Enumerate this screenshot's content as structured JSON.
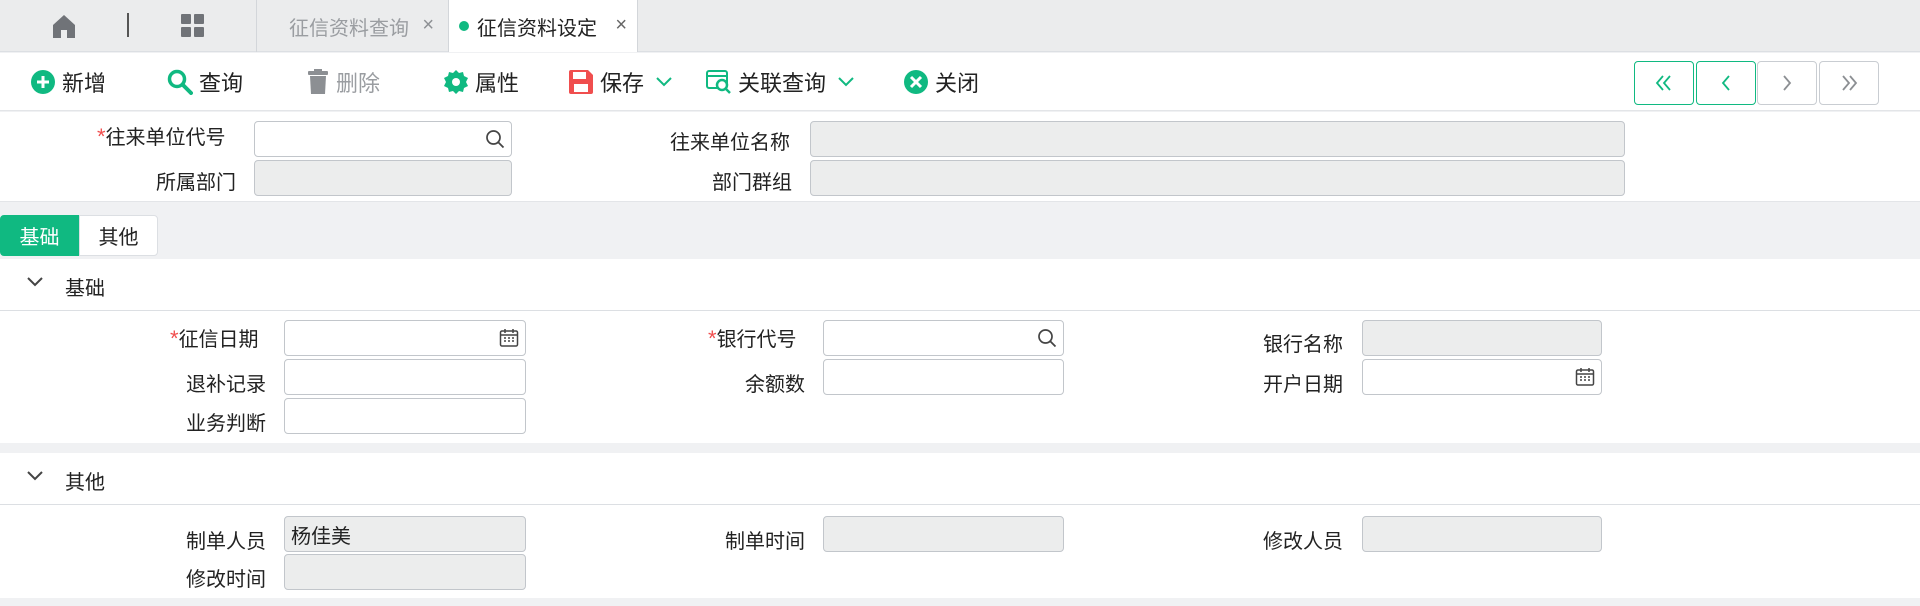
{
  "tabs": [
    {
      "label": "征信资料查询"
    },
    {
      "label": "征信资料设定"
    }
  ],
  "tab_close": "×",
  "toolbar": {
    "new_label": "新增",
    "query_label": "查询",
    "delete_label": "删除",
    "properties_label": "属性",
    "save_label": "保存",
    "related_query_label": "关联查询",
    "close_label": "关闭"
  },
  "header": {
    "partner_code_label": "往来单位代号",
    "partner_code_value": "",
    "partner_name_label": "往来单位名称",
    "department_label": "所属部门",
    "department_group_label": "部门群组"
  },
  "section_tabs": [
    "基础",
    "其他"
  ],
  "basic_section": {
    "title": "基础",
    "credit_date_label": "征信日期",
    "bank_code_label": "银行代号",
    "bank_name_label": "银行名称",
    "refund_record_label": "退补记录",
    "balance_label": "余额数",
    "open_date_label": "开户日期",
    "business_judgment_label": "业务判断"
  },
  "other_section": {
    "title": "其他",
    "creator_label": "制单人员",
    "creator_value": "杨佳美",
    "created_time_label": "制单时间",
    "modifier_label": "修改人员",
    "modified_time_label": "修改时间"
  },
  "required_mark": "*",
  "colors": {
    "accent": "#10b981",
    "required": "#f04e4e",
    "save": "#f04e4e",
    "new": "#10b981"
  },
  "icons": [
    "home-icon",
    "grid-icon",
    "plus-circle-icon",
    "search-icon",
    "trash-icon",
    "gear-icon",
    "save-icon",
    "related-query-icon",
    "close-circle-icon",
    "first-page-icon",
    "prev-page-icon",
    "next-page-icon",
    "last-page-icon",
    "calendar-icon",
    "chevron-down-icon"
  ]
}
